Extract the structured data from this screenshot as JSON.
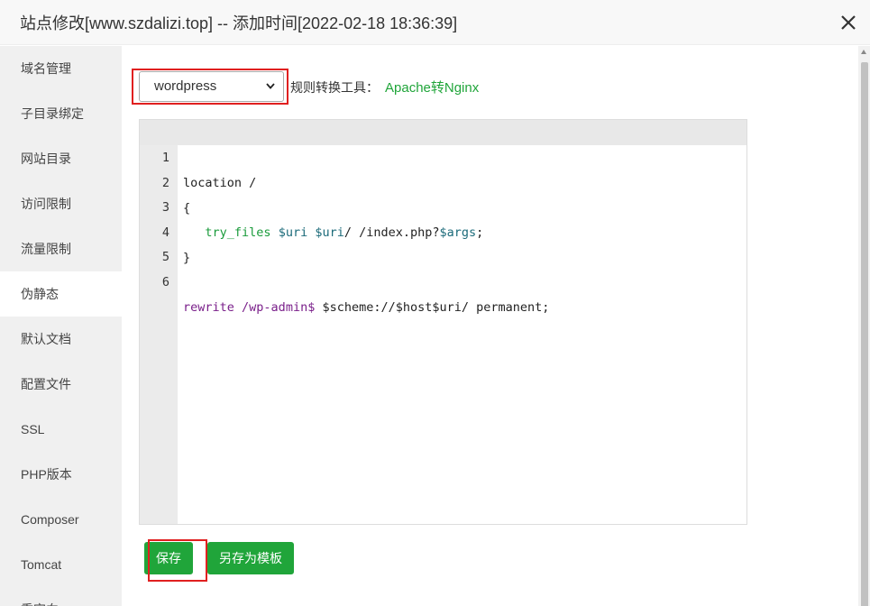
{
  "window": {
    "title": "站点修改[www.szdalizi.top] -- 添加时间[2022-02-18 18:36:39]"
  },
  "sidebar": {
    "items": [
      {
        "label": "域名管理"
      },
      {
        "label": "子目录绑定"
      },
      {
        "label": "网站目录"
      },
      {
        "label": "访问限制"
      },
      {
        "label": "流量限制"
      },
      {
        "label": "伪静态",
        "active": true
      },
      {
        "label": "默认文档"
      },
      {
        "label": "配置文件"
      },
      {
        "label": "SSL"
      },
      {
        "label": "PHP版本"
      },
      {
        "label": "Composer"
      },
      {
        "label": "Tomcat"
      },
      {
        "label": "重定向"
      }
    ]
  },
  "rewrite": {
    "template_select": "wordpress",
    "rule_tool_label": "规则转换工具：",
    "rule_tool_link": "Apache转Nginx"
  },
  "editor": {
    "lines": [
      {
        "num": "1"
      },
      {
        "num": "2"
      },
      {
        "num": "3"
      },
      {
        "num": "4"
      },
      {
        "num": "5"
      },
      {
        "num": "6"
      }
    ],
    "tokens": {
      "l1": "location /",
      "l2": "{",
      "l3_indent": "   ",
      "l3_fn": "try_files",
      "l3_sp": " ",
      "l3_v1": "$uri",
      "l3_v2": "$uri",
      "l3_mid": "/ /index.php?",
      "l3_v3": "$args",
      "l3_end": ";",
      "l4": "}",
      "l6_kw": "rewrite",
      "l6_re": "/wp-admin$",
      "l6_rest": "$scheme://$host$uri/ permanent;"
    }
  },
  "buttons": {
    "save": "保存",
    "save_as_template": "另存为模板"
  },
  "colors": {
    "accent": "#20a53a",
    "highlight": "#e02020"
  }
}
